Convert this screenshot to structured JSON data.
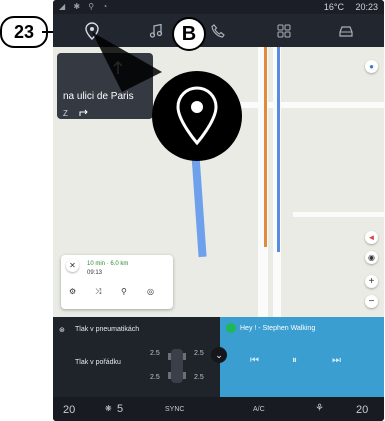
{
  "annotations": {
    "callout_number": "23",
    "callout_letter": "B"
  },
  "status_bar": {
    "temperature": "16°C",
    "time": "20:23"
  },
  "guidance": {
    "street": "na ulici  de Paris",
    "next_label": "Z"
  },
  "route_card": {
    "summary": "10 min · 6.0 km",
    "eta": "09:13"
  },
  "tire_panel": {
    "title": "Tlak v pneumatikách",
    "status": "Tlak v pořádku",
    "front_left": "2.5",
    "front_right": "2.5",
    "rear_left": "2.5",
    "rear_right": "2.5"
  },
  "media": {
    "track": "Hey ! - Stephen Walking"
  },
  "climate": {
    "left_temp": "20",
    "fan_speed": "5",
    "sync_label": "SYNC",
    "ac_label": "A/C",
    "right_temp": "20"
  },
  "colors": {
    "accent_blue": "#3a9ed1",
    "route_orange": "#e08a3c",
    "route_blue": "#5b8be0"
  }
}
